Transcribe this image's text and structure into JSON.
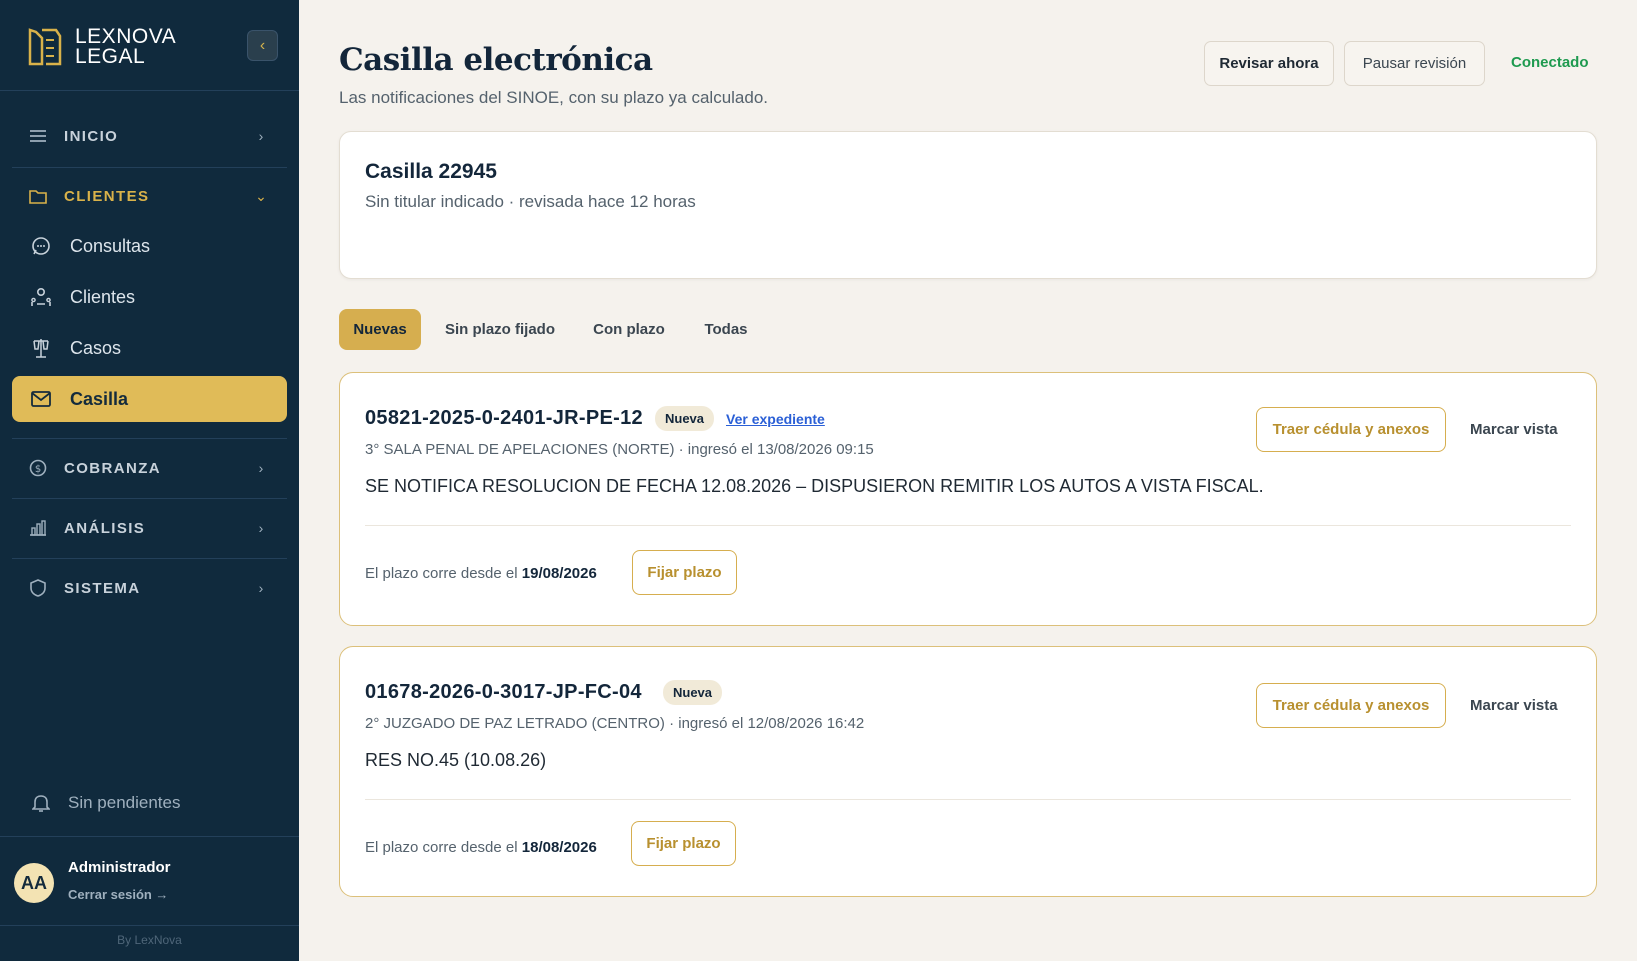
{
  "sidebar": {
    "brand": {
      "line1": "LEXNOVA",
      "line2": "LEGAL"
    },
    "collapse_icon": "chevron-left-icon",
    "sections": {
      "inicio": "INICIO",
      "clientes": "CLIENTES",
      "cobranza": "COBRANZA",
      "analisis": "ANÁLISIS",
      "sistema": "SISTEMA"
    },
    "items": [
      {
        "label": "Consultas",
        "icon": "chat-bubble-icon"
      },
      {
        "label": "Clientes",
        "icon": "users-icon"
      },
      {
        "label": "Casos",
        "icon": "scales-icon"
      },
      {
        "label": "Casilla",
        "icon": "mail-icon",
        "active": true
      }
    ],
    "notifications_label": "Sin pendientes",
    "user": {
      "initials": "AA",
      "name": "Administrador",
      "logout": "Cerrar sesión →"
    },
    "byline": "By LexNova"
  },
  "header": {
    "title": "Casilla electrónica",
    "subtitle": "Las notificaciones del SINOE, con su plazo ya calculado.",
    "btn_review": "Revisar ahora",
    "btn_pause": "Pausar revisión",
    "status": "Conectado"
  },
  "mailbox": {
    "title": "Casilla 22945",
    "subtitle": "Sin titular indicado · revisada hace 12 horas"
  },
  "tabs": [
    {
      "label": "Nuevas",
      "active": true
    },
    {
      "label": "Sin plazo fijado"
    },
    {
      "label": "Con plazo"
    },
    {
      "label": "Todas"
    }
  ],
  "notices": [
    {
      "case_number": "05821-2025-0-2401-JR-PE-12",
      "badge": "Nueva",
      "link": "Ver expediente",
      "court": "3° SALA PENAL DE APELACIONES (NORTE) · ingresó el 13/08/2026 09:15",
      "summary": "SE NOTIFICA RESOLUCION DE FECHA 12.08.2026 – DISPUSIERON REMITIR LOS AUTOS A VISTA FISCAL.",
      "plazo_prefix": "El plazo corre desde el",
      "plazo_date": "19/08/2026",
      "btn_fix": "Fijar plazo",
      "btn_fetch": "Traer cédula y anexos",
      "btn_mark": "Marcar vista"
    },
    {
      "case_number": "01678-2026-0-3017-JP-FC-04",
      "badge": "Nueva",
      "court": "2° JUZGADO DE PAZ LETRADO (CENTRO) · ingresó el 12/08/2026 16:42",
      "summary": "RES NO.45 (10.08.26)",
      "plazo_prefix": "El plazo corre desde el",
      "plazo_date": "18/08/2026",
      "btn_fix": "Fijar plazo",
      "btn_fetch": "Traer cédula y anexos",
      "btn_mark": "Marcar vista"
    }
  ],
  "colors": {
    "sidebar_bg": "#102a3d",
    "accent_gold": "#d6ae4f",
    "status_green": "#1e9a4f",
    "link_blue": "#2a5fd6"
  }
}
